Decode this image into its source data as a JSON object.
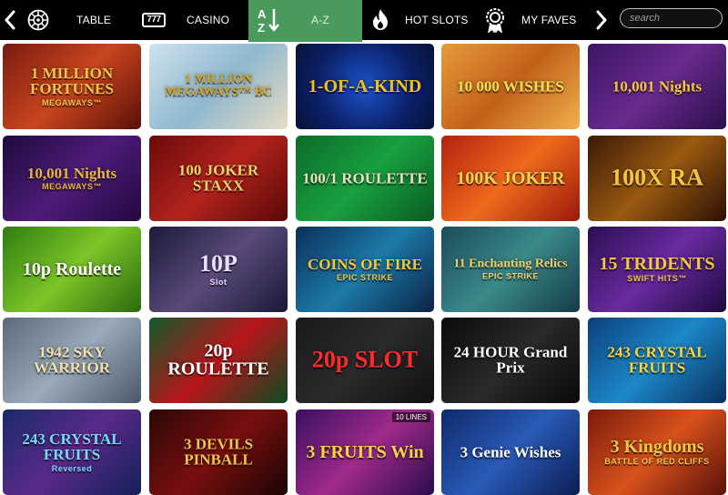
{
  "nav": {
    "table_label": "TABLE",
    "casino_label": "CASINO",
    "az_label": "A-Z",
    "hot_slots_label": "HOT SLOTS",
    "my_faves_label": "MY FAVES",
    "search_placeholder": "search",
    "active_tab": "A-Z",
    "accent_color": "#4a9b5b",
    "icons": [
      "chevron-left-icon",
      "roulette-wheel-icon",
      "slot-777-icon",
      "az-sort-icon",
      "flame-icon",
      "rosette-badge-icon",
      "chevron-right-icon"
    ]
  },
  "games": [
    {
      "title": "1 MILLION FORTUNES",
      "sub": "MEGAWAYS™",
      "bg": "linear-gradient(135deg,#7a1a10,#c8461f 50%,#5a0f08)",
      "color": "#f3c544"
    },
    {
      "title": "1 MILLION MEGAWAYS™ BC",
      "sub": "",
      "bg": "linear-gradient(135deg,#cfe3ee,#8fb8cf 50%,#e8dcc2)",
      "color": "#d9a520"
    },
    {
      "title": "1-OF-A-KIND",
      "sub": "",
      "bg": "radial-gradient(circle at 50% 50%,#1b53c9,#0b1f66 60%,#081237)",
      "color": "#f0c020"
    },
    {
      "title": "10 000 WISHES",
      "sub": "",
      "bg": "linear-gradient(135deg,#e89a3a,#c2611a 50%,#f0b04c)",
      "color": "#f7e04a"
    },
    {
      "title": "10,001 Nights",
      "sub": "",
      "bg": "linear-gradient(135deg,#3a1564,#6a2a8e 50%,#2a0f4a)",
      "color": "#f3c544"
    },
    {
      "title": "10,001 Nights",
      "sub": "MEGAWAYS™",
      "bg": "linear-gradient(135deg,#1e0b3a,#4e1c7a 50%,#22093e)",
      "color": "#e8b640"
    },
    {
      "title": "100 JOKER STAXX",
      "sub": "",
      "bg": "linear-gradient(135deg,#6a0b0b,#b3231c 50%,#5a0808)",
      "color": "#f0d26a"
    },
    {
      "title": "100/1 ROULETTE",
      "sub": "",
      "bg": "linear-gradient(135deg,#0d6a2a,#17a13f 50%,#0b5a23)",
      "color": "#e8e0c0"
    },
    {
      "title": "100K JOKER",
      "sub": "",
      "bg": "linear-gradient(135deg,#b2200e,#f06a1c 50%,#9a180a)",
      "color": "#f7d24a"
    },
    {
      "title": "100X RA",
      "sub": "",
      "bg": "linear-gradient(135deg,#3a1a06,#9a5a10 50%,#2a1004)",
      "color": "#f3c544"
    },
    {
      "title": "10p Roulette",
      "sub": "",
      "bg": "linear-gradient(135deg,#2e7d11,#7cc528 50%,#2a6a0e)",
      "color": "#ffffff"
    },
    {
      "title": "10P",
      "sub": "Slot",
      "bg": "linear-gradient(135deg,#1c1a3a,#5a4a7a 50%,#1a1836)",
      "color": "#e8dcff"
    },
    {
      "title": "COINS OF FIRE",
      "sub": "EPIC STRIKE",
      "bg": "linear-gradient(135deg,#0c2f5a,#1c7aa8 50%,#0b2244)",
      "color": "#f3c544"
    },
    {
      "title": "11 Enchanting Relics",
      "sub": "EPIC STRIKE",
      "bg": "linear-gradient(135deg,#1c4a5a,#3a8a8a 50%,#143a48)",
      "color": "#f0d06a"
    },
    {
      "title": "15 TRIDENTS",
      "sub": "SWIFT HITS™",
      "bg": "linear-gradient(135deg,#2a0f52,#6a2aa0 50%,#1c0a3e)",
      "color": "#f3c544"
    },
    {
      "title": "1942 SKY WARRIOR",
      "sub": "",
      "bg": "linear-gradient(135deg,#5a6a7a,#9aaabb 50%,#4a5866)",
      "color": "#f0e0b0"
    },
    {
      "title": "20p ROULETTE",
      "sub": "",
      "bg": "linear-gradient(135deg,#0f5a2a,#b8161a 50%,#0b4a22)",
      "color": "#ffffff"
    },
    {
      "title": "20p SLOT",
      "sub": "",
      "bg": "linear-gradient(135deg,#1a1a1a,#2a2a2a 50%,#101010)",
      "color": "#ff2a2a"
    },
    {
      "title": "24 HOUR Grand Prix",
      "sub": "",
      "bg": "linear-gradient(135deg,#0a0a0a,#2a2a2a 50%,#0a0a0a)",
      "color": "#ffffff"
    },
    {
      "title": "243 CRYSTAL FRUITS",
      "sub": "",
      "bg": "linear-gradient(135deg,#0c3e7a,#1c88c8 50%,#0a2f5e)",
      "color": "#f3d444"
    },
    {
      "title": "243 CRYSTAL FRUITS",
      "sub": "Reversed",
      "bg": "linear-gradient(135deg,#1a2a6a,#5a2a8a 50%,#122058)",
      "color": "#7ad8ff"
    },
    {
      "title": "3 DEVILS PINBALL",
      "sub": "",
      "bg": "linear-gradient(135deg,#2a0606,#7a0f0f 50%,#1a0404)",
      "color": "#f3c544"
    },
    {
      "title": "3 FRUITS Win",
      "sub": "",
      "tag": "10 LINES",
      "bg": "linear-gradient(135deg,#3a0f62,#a02a8a 50%,#2a0a4a)",
      "color": "#f7d24a"
    },
    {
      "title": "3 Genie Wishes",
      "sub": "",
      "bg": "linear-gradient(135deg,#0e2a6a,#2a5ab8 50%,#0a1e52)",
      "color": "#ffffff"
    },
    {
      "title": "3 Kingdoms",
      "sub": "BATTLE OF RED CLIFFS",
      "bg": "linear-gradient(135deg,#7a1a0a,#d8521c 50%,#5a1006)",
      "color": "#f3c544"
    }
  ]
}
